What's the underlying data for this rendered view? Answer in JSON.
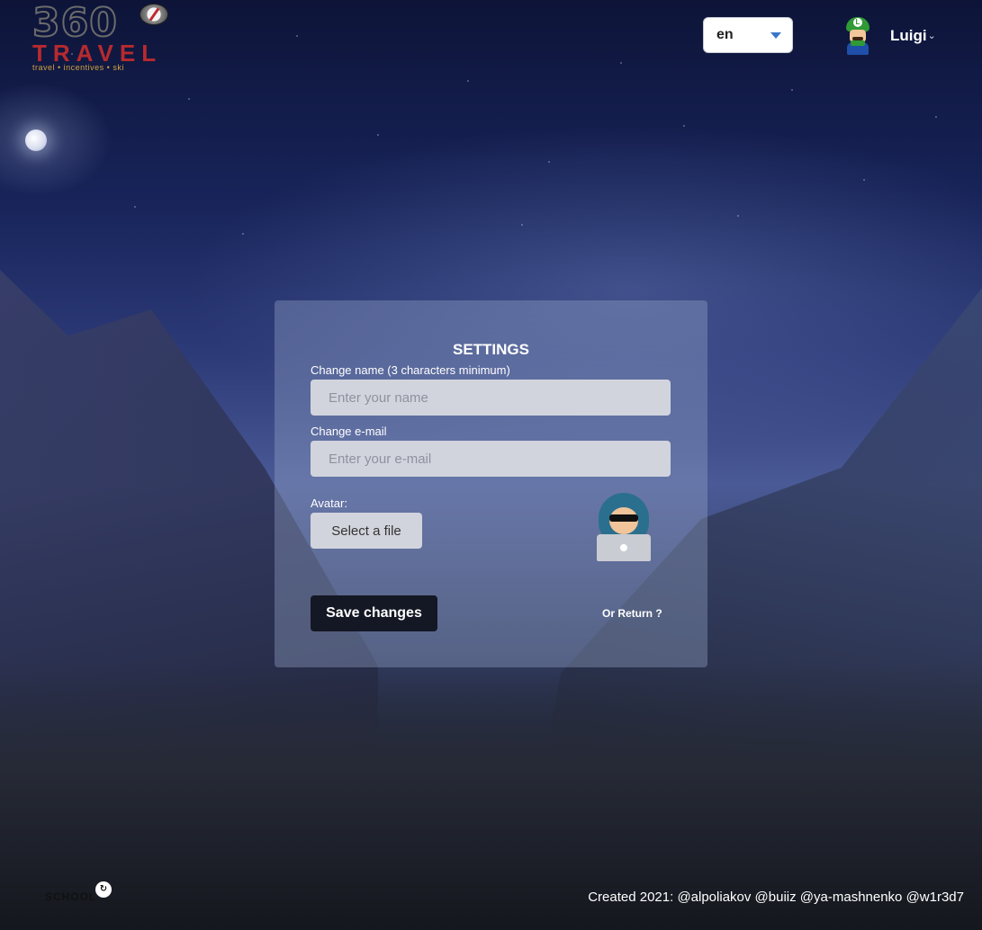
{
  "header": {
    "logo": {
      "number": "360",
      "brand": "TRAVEL",
      "tagline": "travel • incentives • ski"
    },
    "language": {
      "selected": "en"
    },
    "user": {
      "name": "Luigi"
    }
  },
  "settings": {
    "title": "SETTINGS",
    "name_label": "Change name (3 characters minimum)",
    "name_placeholder": "Enter your name",
    "email_label": "Change e-mail",
    "email_placeholder": "Enter your e-mail",
    "avatar_label": "Avatar:",
    "file_button": "Select a file",
    "save_button": "Save changes",
    "return_link": "Or Return ?"
  },
  "footer": {
    "school_logo": "SCHOOL",
    "credits": "Created 2021: @alpoliakov @buiiz @ya-mashnenko @w1r3d7"
  },
  "colors": {
    "brand_red": "#b72a2e",
    "save_button_bg": "#141824",
    "input_bg": "#d2d4dd",
    "lang_caret": "#3a78c8"
  }
}
